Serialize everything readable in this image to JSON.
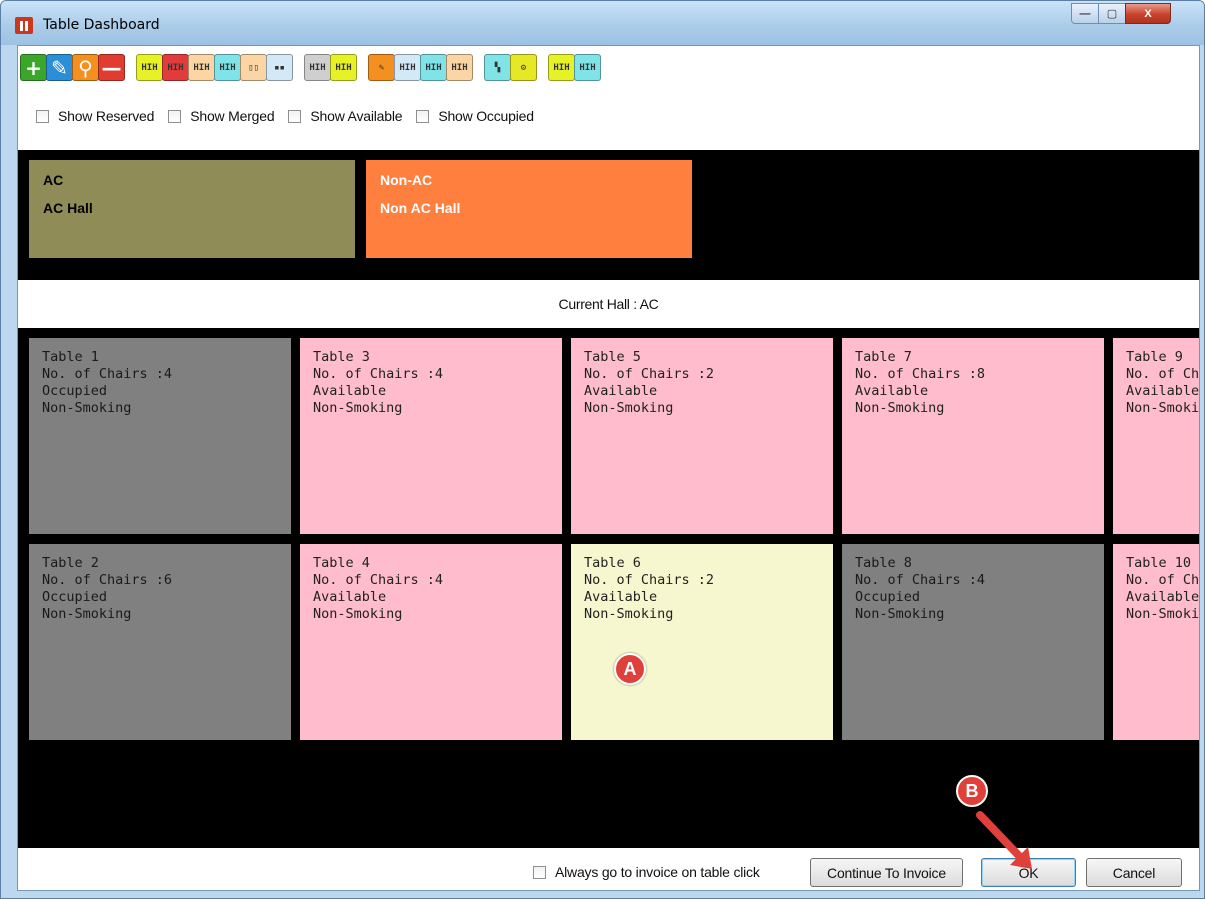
{
  "window": {
    "title": "Table Dashboard",
    "controls": {
      "minimize": "—",
      "maximize": "▢",
      "close": "X"
    }
  },
  "toolbar": {
    "buttons": [
      {
        "name": "add-button",
        "glyph": "+",
        "color": "#3aa62a"
      },
      {
        "name": "edit-button",
        "glyph": "✎",
        "color": "#2a8fd6"
      },
      {
        "name": "search-button",
        "glyph": "⚲",
        "color": "#f3901f"
      },
      {
        "name": "delete-button",
        "glyph": "—",
        "color": "#e23b2f"
      },
      {
        "name": "table-check-button",
        "glyph": "HIH",
        "color": "#e6f227"
      },
      {
        "name": "table-red-button",
        "glyph": "HIH",
        "color": "#e23b3b"
      },
      {
        "name": "table-cancel-button",
        "glyph": "HIH",
        "color": "#fbd6a4"
      },
      {
        "name": "table-download-button",
        "glyph": "HIH",
        "color": "#7fe3e8"
      },
      {
        "name": "table-split-button",
        "glyph": "▯▯",
        "color": "#fbd6a4"
      },
      {
        "name": "table-merge-button",
        "glyph": "▪▪",
        "color": "#d4e9f7"
      },
      {
        "name": "table-status-button",
        "glyph": "HIH",
        "color": "#cfcfcf"
      },
      {
        "name": "table-reserve-button",
        "glyph": "HIH",
        "color": "#e6f227"
      },
      {
        "name": "table-note-button",
        "glyph": "✎",
        "color": "#f3901f"
      },
      {
        "name": "table-line-button",
        "glyph": "HIH",
        "color": "#d4e9f7"
      },
      {
        "name": "table-add-button",
        "glyph": "HIH",
        "color": "#7fe3e8"
      },
      {
        "name": "table-list-button",
        "glyph": "HIH",
        "color": "#fbd6a4"
      },
      {
        "name": "layout-button",
        "glyph": "▚",
        "color": "#7fe3e8"
      },
      {
        "name": "settings-button",
        "glyph": "⚙",
        "color": "#e6e825"
      },
      {
        "name": "table-wave-button",
        "glyph": "HIH",
        "color": "#e6f227"
      },
      {
        "name": "table-undo-button",
        "glyph": "HIH",
        "color": "#7fe3e8"
      }
    ],
    "filters": [
      {
        "label": "Show Reserved",
        "checked": false
      },
      {
        "label": "Show Merged",
        "checked": false
      },
      {
        "label": "Show Available",
        "checked": false
      },
      {
        "label": "Show Occupied",
        "checked": false
      }
    ]
  },
  "halls": [
    {
      "code": "AC",
      "name": "AC Hall",
      "color": "#8f8c58"
    },
    {
      "code": "Non-AC",
      "name": "Non AC Hall",
      "color": "#ff7f3f"
    }
  ],
  "current_hall": "Current Hall : AC",
  "tables": [
    {
      "name": "Table 1",
      "chairs": "No. of Chairs :4",
      "status": "Occupied",
      "smoking": "Non-Smoking"
    },
    {
      "name": "Table 3",
      "chairs": "No. of Chairs :4",
      "status": "Available",
      "smoking": "Non-Smoking"
    },
    {
      "name": "Table 5",
      "chairs": "No. of Chairs :2",
      "status": "Available",
      "smoking": "Non-Smoking"
    },
    {
      "name": "Table 7",
      "chairs": "No. of Chairs :8",
      "status": "Available",
      "smoking": "Non-Smoking"
    },
    {
      "name": "Table 9",
      "chairs": "No. of Chairs :",
      "status": "Available",
      "smoking": "Non-Smoking"
    },
    {
      "name": "Table 2",
      "chairs": "No. of Chairs :6",
      "status": "Occupied",
      "smoking": "Non-Smoking"
    },
    {
      "name": "Table 4",
      "chairs": "No. of Chairs :4",
      "status": "Available",
      "smoking": "Non-Smoking"
    },
    {
      "name": "Table 6",
      "chairs": "No. of Chairs :2",
      "status": "Available",
      "smoking": "Non-Smoking",
      "selected": true
    },
    {
      "name": "Table 8",
      "chairs": "No. of Chairs :4",
      "status": "Occupied",
      "smoking": "Non-Smoking"
    },
    {
      "name": "Table 10",
      "chairs": "No. of Chairs :",
      "status": "Available",
      "smoking": "Non-Smoking"
    }
  ],
  "markers": {
    "a": "A",
    "b": "B"
  },
  "footer": {
    "always_invoice_label": "Always go to invoice on table click",
    "always_invoice_checked": false,
    "continue_label": "Continue To Invoice",
    "ok_label": "OK",
    "cancel_label": "Cancel"
  },
  "colors": {
    "occupied": "#808080",
    "available": "#ffbccc",
    "selected": "#f6f7cf",
    "annotation": "#e0403a"
  }
}
